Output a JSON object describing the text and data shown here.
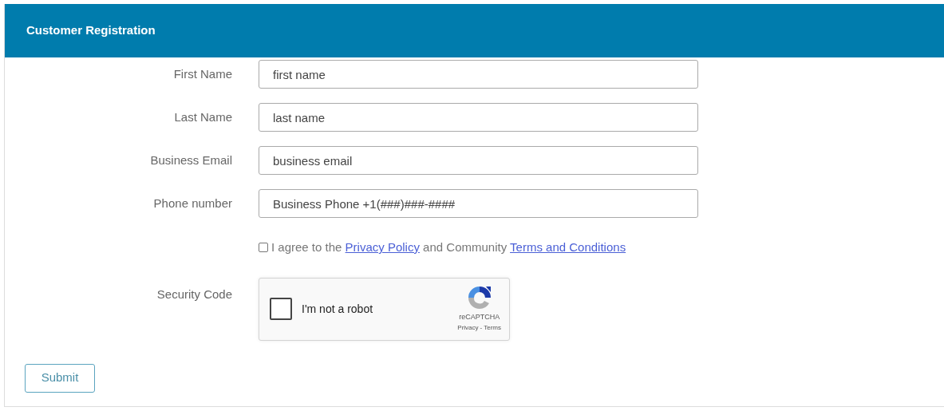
{
  "header": {
    "title": "Customer Registration"
  },
  "fields": [
    {
      "label": "First Name",
      "placeholder": "first name"
    },
    {
      "label": "Last Name",
      "placeholder": "last name"
    },
    {
      "label": "Business Email",
      "placeholder": "business email"
    },
    {
      "label": "Phone number",
      "placeholder": "Business Phone +1(###)###-####"
    }
  ],
  "agreement": {
    "checked": false,
    "parts": [
      {
        "kind": "text",
        "text": "I agree to the"
      },
      {
        "kind": "link",
        "text": "Privacy Policy"
      },
      {
        "kind": "text",
        "text": "and Community"
      },
      {
        "kind": "link",
        "text": "Terms and Conditions"
      }
    ]
  },
  "security": {
    "label": "Security Code",
    "captcha": {
      "checked": false,
      "text": "I'm not a robot",
      "brand": "reCAPTCHA",
      "privacy": "Privacy",
      "separator": "-",
      "terms": "Terms"
    }
  },
  "submit": {
    "label": "Submit"
  }
}
